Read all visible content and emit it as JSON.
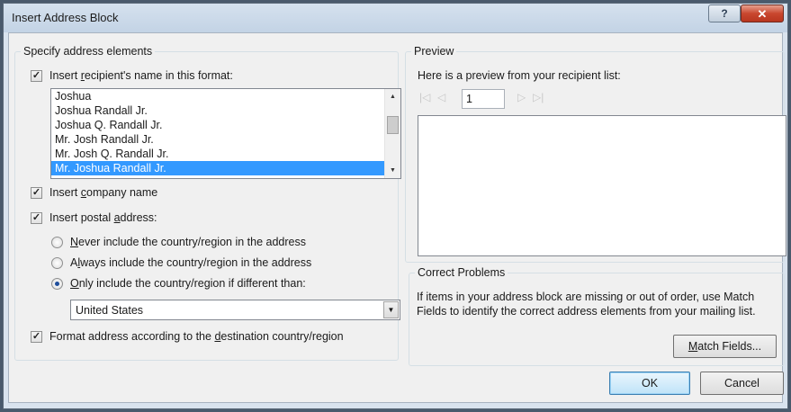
{
  "window": {
    "title": "Insert Address Block",
    "help_label": "?",
    "close_label": "✕"
  },
  "address_elements": {
    "legend": "Specify address elements",
    "recipient_name": {
      "checked": true,
      "label": "Insert recipient's name in this format:",
      "items": [
        "Joshua",
        "Joshua Randall Jr.",
        "Joshua Q. Randall Jr.",
        "Mr. Josh Randall Jr.",
        "Mr. Josh Q. Randall Jr.",
        "Mr. Joshua Randall Jr."
      ],
      "selected_index": 5
    },
    "company_name": {
      "checked": true,
      "label": "Insert company name"
    },
    "postal_address": {
      "checked": true,
      "label": "Insert postal address:",
      "options": [
        "Never include the country/region in the address",
        "Always include the country/region in the address",
        "Only include the country/region if different than:"
      ],
      "selected_option": 2,
      "country_value": "United States"
    },
    "format_by_destination": {
      "checked": true,
      "label": "Format address according to the destination country/region"
    }
  },
  "preview": {
    "legend": "Preview",
    "caption": "Here is a preview from your recipient list:",
    "record_number": "1"
  },
  "correct_problems": {
    "legend": "Correct Problems",
    "text": "If items in your address block are missing or out of order, use Match Fields to identify the correct address elements from your mailing list.",
    "match_fields_label": "Match Fields..."
  },
  "buttons": {
    "ok": "OK",
    "cancel": "Cancel"
  }
}
